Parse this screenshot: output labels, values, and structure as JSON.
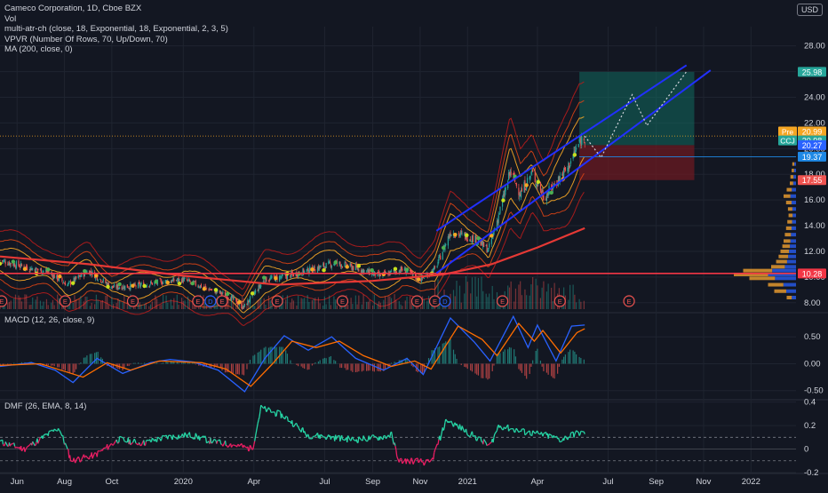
{
  "legend": {
    "title": "Cameco Corporation, 1D, Cboe BZX",
    "lines": [
      "Vol",
      "multi-atr-ch (close, 18, Exponential, 18, Exponential, 2, 3, 5)",
      "VPVR (Number Of Rows, 70, Up/Down, 70)",
      "MA (200, close, 0)"
    ]
  },
  "currency": "USD",
  "macd_label": "MACD (12, 26, close, 9)",
  "dmf_label": "DMF (26, EMA, 8, 14)",
  "colors": {
    "bg": "#131722",
    "grid": "#1f2430",
    "text": "#d1d4dc",
    "up": "#26a69a",
    "down": "#ef5350",
    "ma": "#e53935",
    "channel": "#2130ff",
    "support": "#f23645",
    "macd": "#2962ff",
    "signal": "#ff6d00",
    "dmf_up": "#26d4a4",
    "dmf_down": "#e91e63",
    "pre": "#f5a623",
    "target": "#10695f",
    "stop": "#6b1a22"
  },
  "chart_data": [
    {
      "type": "candlestick",
      "title": "Cameco Corporation, 1D, Cboe BZX",
      "ylim": [
        7.5,
        29.5
      ],
      "yticks": [
        "8.00",
        "10.00",
        "12.00",
        "14.00",
        "16.00",
        "18.00",
        "20.00",
        "22.00",
        "24.00",
        "26.00",
        "28.00"
      ],
      "xticks": [
        "Jun",
        "Aug",
        "Oct",
        "2020",
        "Apr",
        "Jul",
        "Sep",
        "Nov",
        "2021",
        "Apr",
        "Jul",
        "Sep",
        "Nov",
        "2022"
      ],
      "x_range": [
        "2019-05-10",
        "2022-02-28"
      ],
      "price_path": [
        [
          "2019-05-10",
          11.3
        ],
        [
          "2019-06-10",
          10.8
        ],
        [
          "2019-07-10",
          10.4
        ],
        [
          "2019-08-05",
          9.4
        ],
        [
          "2019-09-01",
          10.5
        ],
        [
          "2019-10-01",
          9.2
        ],
        [
          "2019-11-01",
          9.3
        ],
        [
          "2019-12-01",
          9.6
        ],
        [
          "2020-01-01",
          9.8
        ],
        [
          "2020-02-01",
          9.1
        ],
        [
          "2020-03-01",
          8.5
        ],
        [
          "2020-03-18",
          7.6
        ],
        [
          "2020-04-15",
          9.8
        ],
        [
          "2020-05-15",
          10.1
        ],
        [
          "2020-06-15",
          10.6
        ],
        [
          "2020-07-15",
          11.1
        ],
        [
          "2020-08-10",
          10.7
        ],
        [
          "2020-09-10",
          10.1
        ],
        [
          "2020-10-10",
          10.6
        ],
        [
          "2020-11-01",
          9.8
        ],
        [
          "2020-11-20",
          10.6
        ],
        [
          "2020-12-10",
          13.5
        ],
        [
          "2021-01-10",
          13.0
        ],
        [
          "2021-01-28",
          12.1
        ],
        [
          "2021-02-10",
          14.8
        ],
        [
          "2021-02-25",
          18.2
        ],
        [
          "2021-03-10",
          16.5
        ],
        [
          "2021-03-25",
          18.1
        ],
        [
          "2021-04-10",
          16.2
        ],
        [
          "2021-04-25",
          17.4
        ],
        [
          "2021-05-10",
          18.5
        ],
        [
          "2021-05-25",
          20.5
        ],
        [
          "2021-06-01",
          20.98
        ]
      ],
      "ma200_path": [
        [
          "2019-05-10",
          11.6
        ],
        [
          "2019-09-01",
          11.0
        ],
        [
          "2020-01-01",
          10.1
        ],
        [
          "2020-05-01",
          9.4
        ],
        [
          "2020-09-01",
          9.7
        ],
        [
          "2020-12-01",
          10.2
        ],
        [
          "2021-02-01",
          11.0
        ],
        [
          "2021-04-01",
          12.3
        ],
        [
          "2021-06-01",
          13.8
        ]
      ],
      "channel_upper": [
        [
          "2020-11-22",
          13.6
        ],
        [
          "2021-10-10",
          26.5
        ]
      ],
      "channel_lower": [
        [
          "2020-11-22",
          10.3
        ],
        [
          "2021-11-10",
          26.1
        ]
      ],
      "projection_path": [
        [
          "2021-06-01",
          20.98
        ],
        [
          "2021-06-22",
          19.3
        ],
        [
          "2021-08-01",
          24.2
        ],
        [
          "2021-08-20",
          21.8
        ],
        [
          "2021-10-10",
          26.0
        ]
      ],
      "position": {
        "entry": 20.27,
        "target": 25.98,
        "stop": 17.55,
        "start": "2021-05-25",
        "end": "2021-10-20"
      },
      "support_level": 10.28,
      "events": [
        "2019-05-12",
        "2019-08-02",
        "2019-10-28",
        "2020-01-20",
        "2020-02-05",
        "2020-02-20",
        "2020-05-01",
        "2020-07-24",
        "2020-10-28",
        "2020-11-20",
        "2020-12-03",
        "2021-02-15",
        "2021-04-30",
        "2021-07-28"
      ],
      "event_labels": [
        "E",
        "E",
        "E",
        "E",
        "D",
        "E",
        "E",
        "E",
        "E",
        "E",
        "D",
        "E",
        "E",
        "E"
      ],
      "vp_profile": [
        [
          8.4,
          0.15
        ],
        [
          8.9,
          0.35
        ],
        [
          9.4,
          0.45
        ],
        [
          9.9,
          0.75
        ],
        [
          10.2,
          1.0
        ],
        [
          10.5,
          0.85
        ],
        [
          10.8,
          0.4
        ],
        [
          11.2,
          0.32
        ],
        [
          11.6,
          0.28
        ],
        [
          12.0,
          0.25
        ],
        [
          12.4,
          0.22
        ],
        [
          12.8,
          0.2
        ],
        [
          13.3,
          0.18
        ],
        [
          13.8,
          0.16
        ],
        [
          14.3,
          0.14
        ],
        [
          14.8,
          0.12
        ],
        [
          15.3,
          0.13
        ],
        [
          15.8,
          0.16
        ],
        [
          16.3,
          0.2
        ],
        [
          16.8,
          0.15
        ],
        [
          17.3,
          0.1
        ],
        [
          17.8,
          0.09
        ],
        [
          18.3,
          0.07
        ],
        [
          18.8,
          0.06
        ]
      ],
      "price_labels": [
        {
          "text": "25.98",
          "value": 25.98,
          "color": "#26a69a"
        },
        {
          "text": "20.99",
          "value": 20.99,
          "color": "#f5a623"
        },
        {
          "text": "20.98",
          "value": 20.98,
          "color": "#26a69a"
        },
        {
          "text": "20.27",
          "value": 20.27,
          "color": "#2962ff"
        },
        {
          "text": "19.37",
          "value": 19.37,
          "color": "#1e88e5"
        },
        {
          "text": "17.55",
          "value": 17.55,
          "color": "#ef5350"
        },
        {
          "text": "10.28",
          "value": 10.28,
          "color": "#f23645"
        }
      ],
      "tags": [
        {
          "text": "Pre",
          "value": 20.99
        },
        {
          "text": "CCJ",
          "value": 20.98
        }
      ]
    },
    {
      "type": "line",
      "title": "MACD (12, 26, close, 9)",
      "ylim": [
        -0.67,
        0.95
      ],
      "yticks": [
        "-0.50",
        "0.00",
        "0.50"
      ],
      "macd_path": [
        [
          "2019-05-10",
          -0.05
        ],
        [
          "2019-06-20",
          0.02
        ],
        [
          "2019-07-20",
          -0.12
        ],
        [
          "2019-08-12",
          -0.35
        ],
        [
          "2019-09-12",
          0.1
        ],
        [
          "2019-10-15",
          -0.18
        ],
        [
          "2019-11-20",
          0.02
        ],
        [
          "2019-12-15",
          0.08
        ],
        [
          "2020-01-15",
          0.03
        ],
        [
          "2020-02-15",
          -0.12
        ],
        [
          "2020-03-20",
          -0.52
        ],
        [
          "2020-04-15",
          0.1
        ],
        [
          "2020-05-10",
          0.52
        ],
        [
          "2020-06-10",
          0.25
        ],
        [
          "2020-07-10",
          0.5
        ],
        [
          "2020-08-10",
          0.1
        ],
        [
          "2020-09-15",
          -0.12
        ],
        [
          "2020-10-15",
          0.1
        ],
        [
          "2020-11-05",
          -0.2
        ],
        [
          "2020-12-10",
          0.85
        ],
        [
          "2021-01-10",
          0.4
        ],
        [
          "2021-01-30",
          0.05
        ],
        [
          "2021-03-01",
          0.88
        ],
        [
          "2021-03-20",
          0.3
        ],
        [
          "2021-04-01",
          0.72
        ],
        [
          "2021-04-25",
          0.05
        ],
        [
          "2021-05-15",
          0.7
        ],
        [
          "2021-06-01",
          0.72
        ]
      ],
      "signal_path": [
        [
          "2019-05-10",
          -0.03
        ],
        [
          "2019-07-01",
          0.0
        ],
        [
          "2019-08-25",
          -0.25
        ],
        [
          "2019-09-25",
          0.02
        ],
        [
          "2019-10-25",
          -0.12
        ],
        [
          "2019-12-01",
          0.05
        ],
        [
          "2020-01-25",
          0.02
        ],
        [
          "2020-02-25",
          -0.1
        ],
        [
          "2020-03-28",
          -0.42
        ],
        [
          "2020-04-25",
          0.0
        ],
        [
          "2020-05-20",
          0.42
        ],
        [
          "2020-06-20",
          0.3
        ],
        [
          "2020-07-20",
          0.42
        ],
        [
          "2020-08-20",
          0.15
        ],
        [
          "2020-09-25",
          -0.05
        ],
        [
          "2020-10-25",
          0.05
        ],
        [
          "2020-11-15",
          -0.1
        ],
        [
          "2020-12-20",
          0.7
        ],
        [
          "2021-01-20",
          0.45
        ],
        [
          "2021-02-08",
          0.15
        ],
        [
          "2021-03-08",
          0.75
        ],
        [
          "2021-03-28",
          0.42
        ],
        [
          "2021-04-08",
          0.62
        ],
        [
          "2021-05-01",
          0.2
        ],
        [
          "2021-05-22",
          0.58
        ],
        [
          "2021-06-01",
          0.65
        ]
      ]
    },
    {
      "type": "area",
      "title": "DMF (26, EMA, 8, 14)",
      "ylim": [
        -0.2,
        0.42
      ],
      "yticks": [
        "-0.2",
        "0",
        "0.2",
        "0.4"
      ],
      "level_lines": [
        0.1,
        -0.1
      ],
      "dmf_path": [
        [
          "2019-05-10",
          0.06
        ],
        [
          "2019-06-10",
          0.0
        ],
        [
          "2019-07-05",
          0.1
        ],
        [
          "2019-07-25",
          0.18
        ],
        [
          "2019-08-10",
          -0.1
        ],
        [
          "2019-09-10",
          -0.05
        ],
        [
          "2019-10-10",
          0.08
        ],
        [
          "2019-11-10",
          0.05
        ],
        [
          "2019-12-10",
          0.1
        ],
        [
          "2020-01-10",
          0.12
        ],
        [
          "2020-02-10",
          0.06
        ],
        [
          "2020-03-10",
          0.03
        ],
        [
          "2020-03-30",
          0.0
        ],
        [
          "2020-04-10",
          0.35
        ],
        [
          "2020-05-10",
          0.28
        ],
        [
          "2020-06-10",
          0.12
        ],
        [
          "2020-07-10",
          0.1
        ],
        [
          "2020-08-10",
          0.08
        ],
        [
          "2020-09-10",
          0.1
        ],
        [
          "2020-09-25",
          0.12
        ],
        [
          "2020-10-05",
          -0.1
        ],
        [
          "2020-10-25",
          -0.1
        ],
        [
          "2020-11-15",
          -0.12
        ],
        [
          "2020-12-05",
          0.25
        ],
        [
          "2021-01-05",
          0.13
        ],
        [
          "2021-01-30",
          0.02
        ],
        [
          "2021-02-10",
          0.2
        ],
        [
          "2021-03-10",
          0.15
        ],
        [
          "2021-04-10",
          0.12
        ],
        [
          "2021-05-01",
          0.08
        ],
        [
          "2021-05-20",
          0.13
        ],
        [
          "2021-06-01",
          0.14
        ]
      ]
    }
  ]
}
